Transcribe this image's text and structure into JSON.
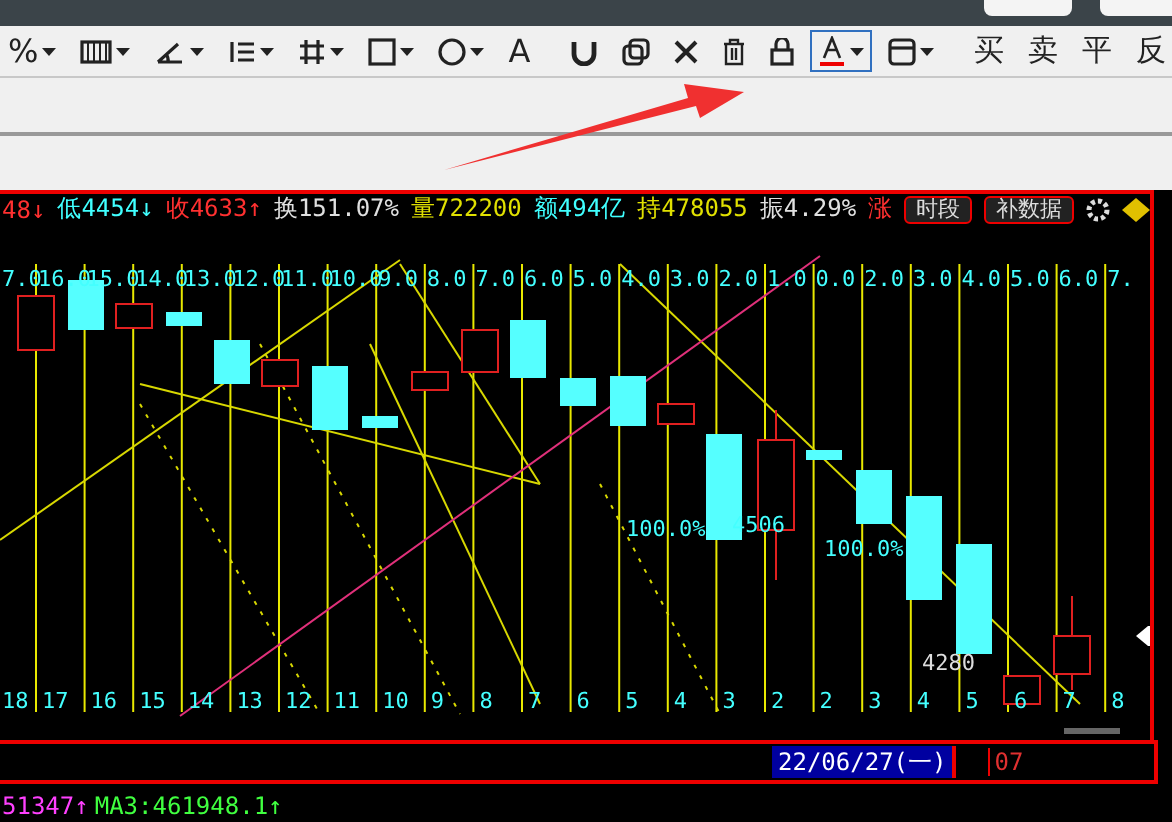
{
  "toolbar": {
    "tools": [
      {
        "kind": "glyph",
        "label": "%",
        "dropdown": true,
        "selected": false
      },
      {
        "kind": "columns",
        "dropdown": true,
        "selected": false
      },
      {
        "kind": "angle",
        "dropdown": true,
        "selected": false
      },
      {
        "kind": "list",
        "dropdown": true,
        "selected": false
      },
      {
        "kind": "grid",
        "dropdown": true,
        "selected": false
      },
      {
        "kind": "rect",
        "dropdown": true,
        "selected": false
      },
      {
        "kind": "circle",
        "dropdown": true,
        "selected": false
      },
      {
        "kind": "glyph",
        "label": "A",
        "dropdown": false,
        "selected": false
      },
      {
        "kind": "magnet",
        "dropdown": false,
        "selected": false
      },
      {
        "kind": "copy",
        "dropdown": false,
        "selected": false
      },
      {
        "kind": "close",
        "dropdown": false,
        "selected": false
      },
      {
        "kind": "trash",
        "dropdown": false,
        "selected": false
      },
      {
        "kind": "lock",
        "dropdown": false,
        "selected": false
      },
      {
        "kind": "textcolor",
        "dropdown": true,
        "selected": true
      },
      {
        "kind": "frame",
        "dropdown": true,
        "selected": false
      }
    ],
    "trade_buttons": [
      "买",
      "卖",
      "平",
      "反"
    ]
  },
  "quote_bar": {
    "items": [
      {
        "text": "48↓",
        "color": "#ff3030"
      },
      {
        "text": "低4454↓",
        "color": "#40ffff"
      },
      {
        "text": "收4633↑",
        "color": "#ff3030"
      },
      {
        "text": "换151.07%",
        "color": "#e0e0e0"
      },
      {
        "text": "量722200",
        "color": "#e0e000"
      },
      {
        "text": "额494亿",
        "color": "#40ffff"
      },
      {
        "text": "持478055",
        "color": "#e0e000"
      },
      {
        "text": "振4.29%",
        "color": "#e0e0e0"
      },
      {
        "text": "涨",
        "color": "#ff3030"
      }
    ],
    "buttons": [
      "时段",
      "补数据"
    ]
  },
  "chart": {
    "top_labels": [
      "7.0",
      "16.0",
      "15.0",
      "14.0",
      "13.0",
      "12.0",
      "11.0",
      "10.0",
      "9.0",
      "8.0",
      "7.0",
      "6.0",
      "5.0",
      "4.0",
      "3.0",
      "2.0",
      "1.0",
      "0.0",
      "2.0",
      "3.0",
      "4.0",
      "5.0",
      "6.0",
      "7."
    ],
    "bottom_labels": [
      "18",
      "17",
      "16",
      "15",
      "14",
      "13",
      "12",
      "11",
      "10",
      "9",
      "8",
      "7",
      "6",
      "5",
      "4",
      "3",
      "2",
      "2",
      "3",
      "4",
      "5",
      "6",
      "7",
      "8"
    ],
    "annotations": [
      "100.0%",
      "4506",
      "100.0%",
      "4280"
    ]
  },
  "time_axis": {
    "date": "22/06/27(一)",
    "next": "07"
  },
  "indicator_bar": {
    "items": [
      {
        "text": "51347↑",
        "color": "#ff40ff"
      },
      {
        "text": "MA3:461948.1↑",
        "color": "#40ff40"
      }
    ]
  }
}
